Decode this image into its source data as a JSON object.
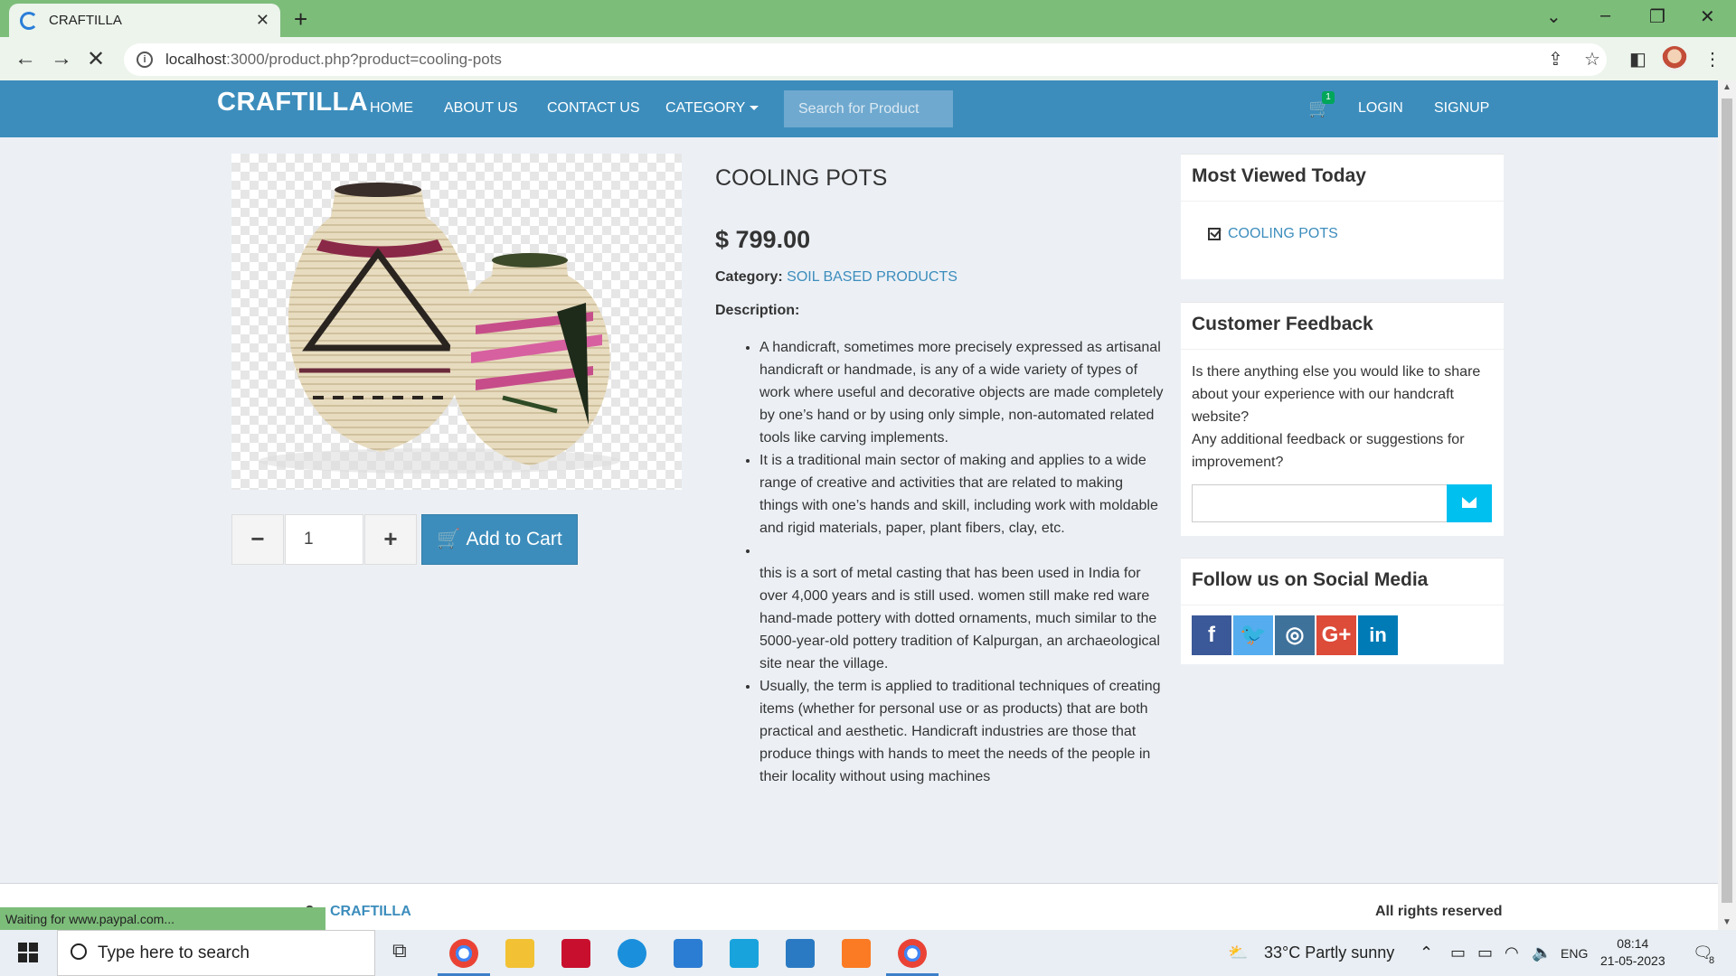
{
  "browser": {
    "tab_title": "CRAFTILLA",
    "url_host": "localhost",
    "url_rest": ":3000/product.php?product=cooling-pots",
    "status_text": "Waiting for www.paypal.com..."
  },
  "site": {
    "brand": "CRAFTILLA",
    "nav": [
      "HOME",
      "ABOUT US",
      "CONTACT US",
      "CATEGORY"
    ],
    "search_placeholder": "Search for Product",
    "cart_count": "1",
    "login": "LOGIN",
    "signup": "SIGNUP"
  },
  "product": {
    "title": "COOLING POTS",
    "price": "$ 799.00",
    "category_label": "Category:",
    "category_value": "SOIL BASED PRODUCTS",
    "description_label": "Description:",
    "quantity": "1",
    "add_to_cart": "Add to Cart",
    "description": [
      "A handicraft, sometimes more precisely expressed as artisanal handicraft or handmade, is any of a wide variety of types of work where useful and decorative objects are made completely by one’s hand or by using only simple, non-automated related tools like carving implements.",
      " It is a traditional main sector of making and applies to a wide range of creative and activities that are related to making things with one’s hands and skill, including work with moldable and rigid materials, paper, plant fibers, clay, etc.",
      "",
      "this is a sort of metal casting that has been used in India for over 4,000 years and is still used. women still make red ware hand-made pottery with dotted ornaments, much similar to the 5000-year-old pottery tradition of Kalpurgan, an archaeological site near the village.",
      "Usually, the term is applied to traditional techniques of creating items (whether for personal use or as products) that are both practical and aesthetic. Handicraft industries are those that produce things with hands to meet the needs of the people in their locality without using machines"
    ]
  },
  "sidebar": {
    "most_viewed_title": "Most Viewed Today",
    "most_viewed_item": "COOLING POTS",
    "feedback_title": "Customer Feedback",
    "feedback_q1": "Is there anything else you would like to share about your experience with our handcraft website?",
    "feedback_q2": "Any additional feedback or suggestions for improvement?",
    "social_title": "Follow us on Social Media"
  },
  "footer": {
    "copy_prefix": "3",
    "brand": "CRAFTILLA",
    "rights": "All rights reserved"
  },
  "taskbar": {
    "search_placeholder": "Type here to search",
    "weather": "33°C  Partly sunny",
    "lang": "ENG",
    "time": "08:14",
    "date": "21-05-2023",
    "notification_count": "8"
  },
  "colors": {
    "navbar": "#3c8dbc",
    "browser_frame": "#7dbd7a",
    "page_bg": "#ecf0f5",
    "facebook": "#3b5998",
    "twitter": "#55acee",
    "instagram": "#3f729b",
    "google_plus": "#dd4b39",
    "linkedin": "#007bb6"
  }
}
